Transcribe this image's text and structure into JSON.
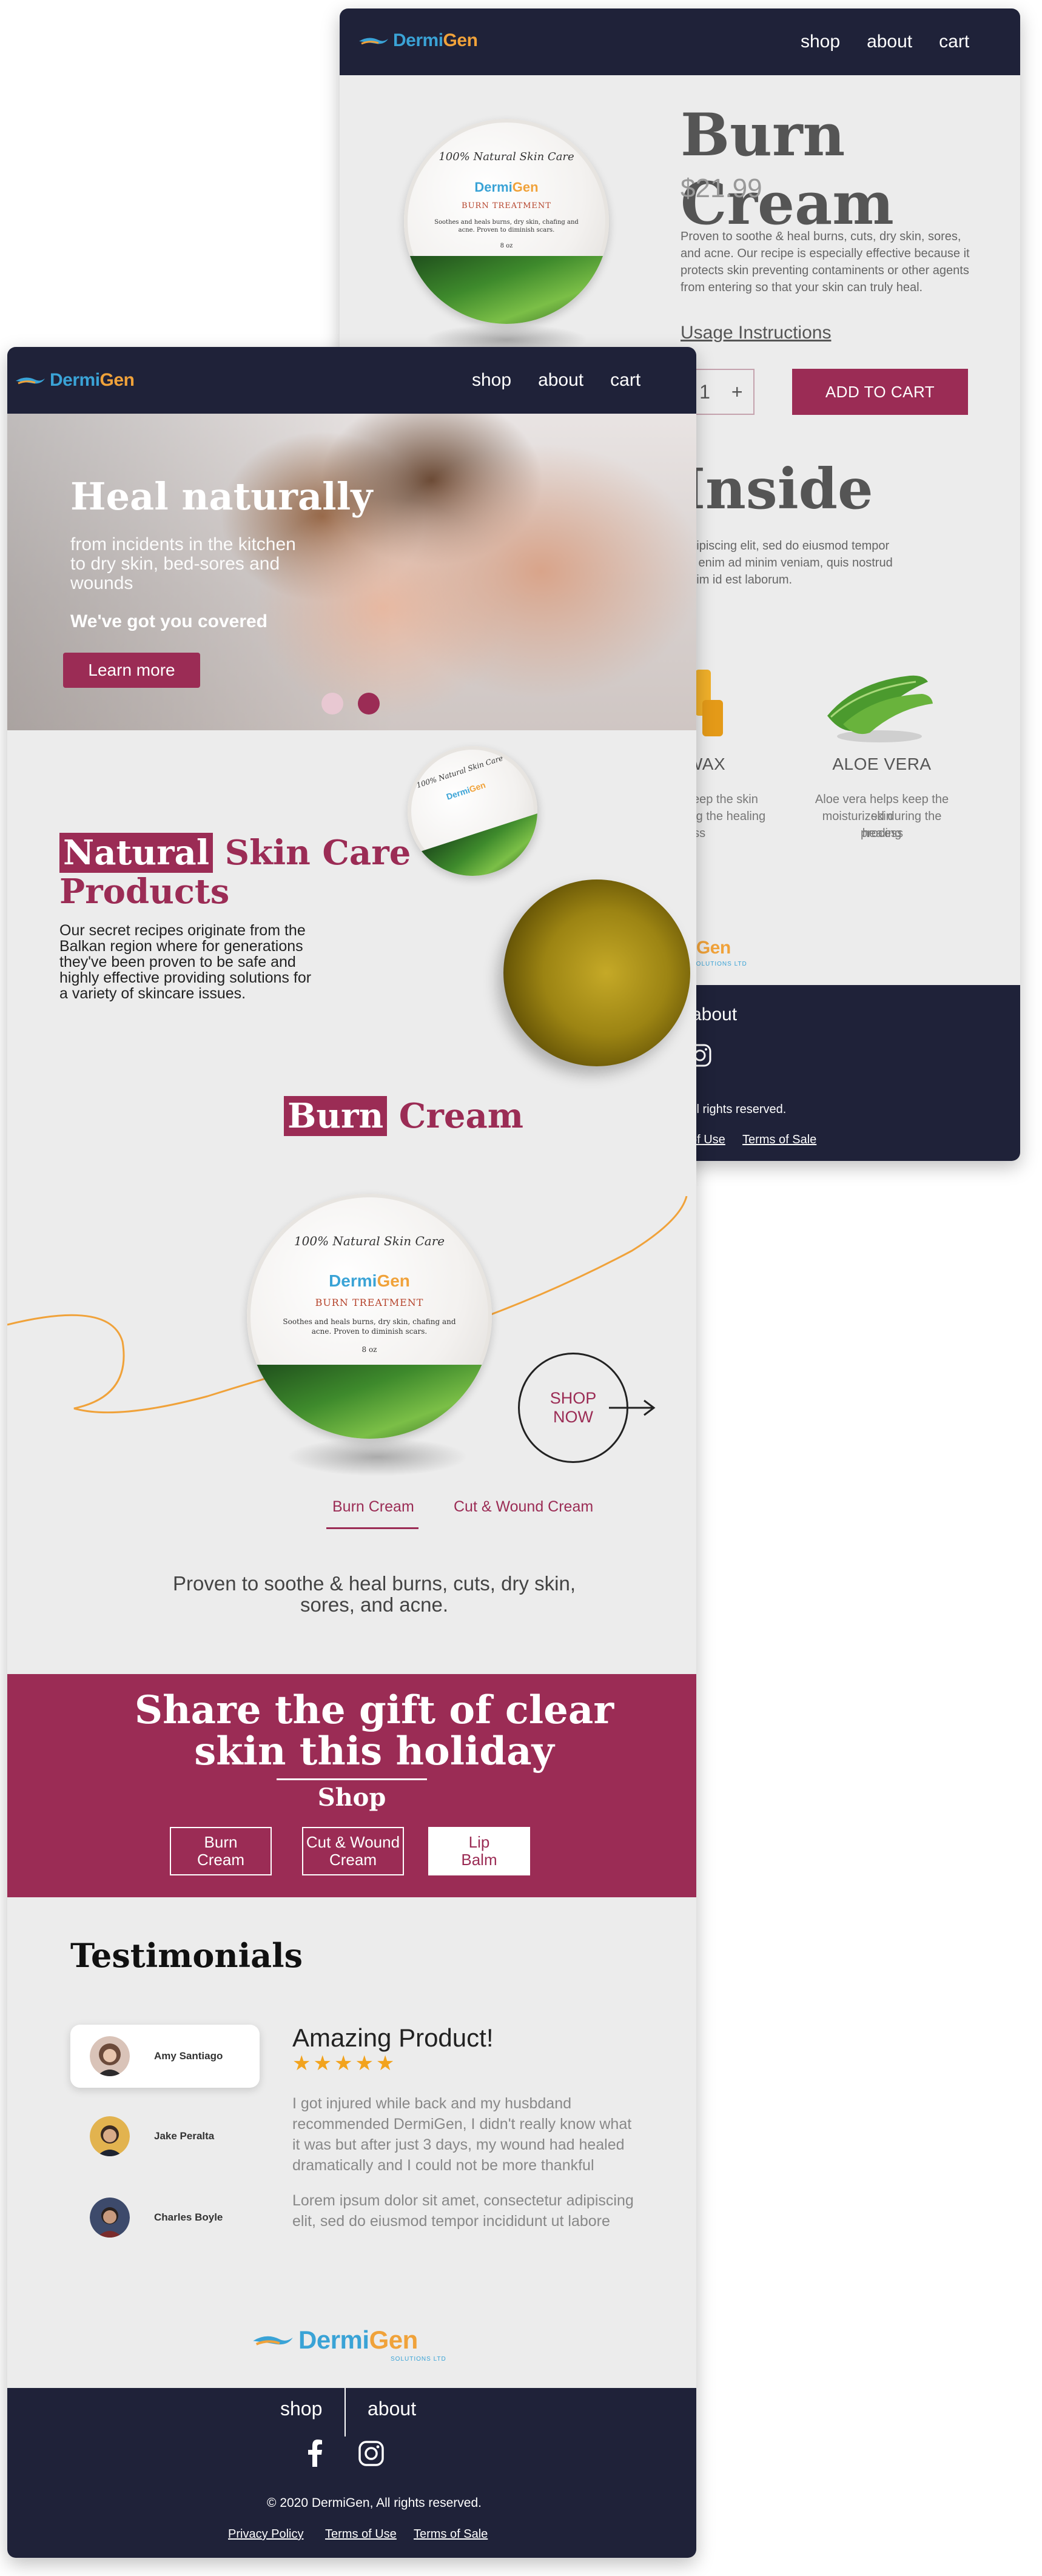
{
  "brand": {
    "name_a": "Dermi",
    "name_b": "Gen",
    "tagline": "SOLUTIONS LTD"
  },
  "nav": {
    "shop": "shop",
    "about": "about",
    "cart": "cart"
  },
  "jar": {
    "arc": "100% Natural Skin Care",
    "treatment": "BURN TREATMENT",
    "desc": "Soothes and heals burns, dry skin, chafing and acne. Proven to diminish scars.",
    "size": "8 oz"
  },
  "product": {
    "title": "Burn Cream",
    "price": "$21.99",
    "description": "Proven to soothe & heal burns, cuts, dry skin, sores, and acne. Our recipe is especially effective because it protects skin preventing contaminents or other agents from entering so that your skin can truly heal.",
    "usage": "Usage Instructions",
    "qty_minus": "-",
    "qty_value": "1",
    "qty_plus": "+",
    "add_to_cart": "ADD TO CART",
    "inside_title": "Inside",
    "inside_desc_1": "adipiscing elit, sed do eiusmod tempor",
    "inside_desc_2": "Ut enim ad minim veniam, quis nostrud",
    "inside_desc_3": "anim id est laborum.",
    "ingredients": [
      {
        "name": "WAX",
        "desc_1": "keep the skin",
        "desc_2": "ing the healing",
        "desc_3": "ess"
      },
      {
        "name": "ALOE VERA",
        "desc_1": "Aloe vera helps keep the skin",
        "desc_2": "moisturized during the healing",
        "desc_3": "process"
      }
    ],
    "logo_fragment_a": "i",
    "logo_fragment_b": "Gen",
    "logo_fragment_sub": "SOLUTIONS LTD",
    "footer_about": "about",
    "footer_rights": "ll rights reserved.",
    "footer_terms_use": "of Use",
    "footer_terms_sale": "Terms of Sale"
  },
  "hero": {
    "title": "Heal naturally",
    "subtitle_1": "from incidents in the kitchen",
    "subtitle_2": "to dry skin, bed-sores and",
    "subtitle_3": "wounds",
    "tagline": "We've got you covered",
    "cta": "Learn more",
    "slides": [
      {
        "active": false
      },
      {
        "active": true
      }
    ]
  },
  "natural": {
    "title_hl": "Natural",
    "title_rest": " Skin Care",
    "title_line2": "Products",
    "body_1": "Our secret recipes originate from the",
    "body_2": "Balkan region where for generations",
    "body_3": "they've been proven to be safe and",
    "body_4": "highly effective providing solutions for",
    "body_5": "a variety of skincare issues."
  },
  "featured": {
    "title_hl": "Burn",
    "title_rest": " Cream",
    "shop_now_1": "SHOP",
    "shop_now_2": "NOW",
    "tabs": [
      {
        "label": "Burn Cream",
        "active": true
      },
      {
        "label": "Cut & Wound Cream",
        "active": false
      }
    ],
    "proven_1": "Proven to soothe & heal burns, cuts, dry skin,",
    "proven_2": "sores, and acne."
  },
  "gift": {
    "title_1": "Share the gift of clear",
    "title_2": "skin this holiday",
    "shop": "Shop",
    "buttons": [
      {
        "line1": "Burn",
        "line2": "Cream",
        "active": false
      },
      {
        "line1": "Cut & Wound",
        "line2": "Cream",
        "active": false
      },
      {
        "line1": "Lip",
        "line2": "Balm",
        "active": true
      }
    ]
  },
  "testimonials": {
    "title": "Testimonials",
    "people": [
      {
        "name": "Amy Santiago",
        "active": true,
        "color": "#6b4a3a"
      },
      {
        "name": "Jake Peralta",
        "active": false,
        "color": "#c9a046"
      },
      {
        "name": "Charles Boyle",
        "active": false,
        "color": "#3d4a6b"
      }
    ],
    "review_title": "Amazing Product!",
    "stars": "★★★★★",
    "rating": 5,
    "review_1": "I got injured while back and my husbdand",
    "review_2": "recommended DermiGen,  I didn't really know what",
    "review_3": "it was but after just 3 days, my wound had healed",
    "review_4": "dramatically and I could not be more thankful",
    "lorem_1": "Lorem ipsum dolor sit amet, consectetur adipiscing",
    "lorem_2": "elit, sed do eiusmod tempor incididunt ut labore"
  },
  "footer": {
    "shop": "shop",
    "about": "about",
    "rights": "© 2020 DermiGen, All rights reserved.",
    "privacy": "Privacy Policy",
    "terms_use": "Terms of Use",
    "terms_sale": "Terms of Sale"
  },
  "colors": {
    "primary": "#9b2c55",
    "navy": "#1f2239",
    "gray_bg": "#ececec",
    "logo_blue": "#3aa3d6",
    "logo_orange": "#f0a23a",
    "star": "#f2a31d"
  }
}
